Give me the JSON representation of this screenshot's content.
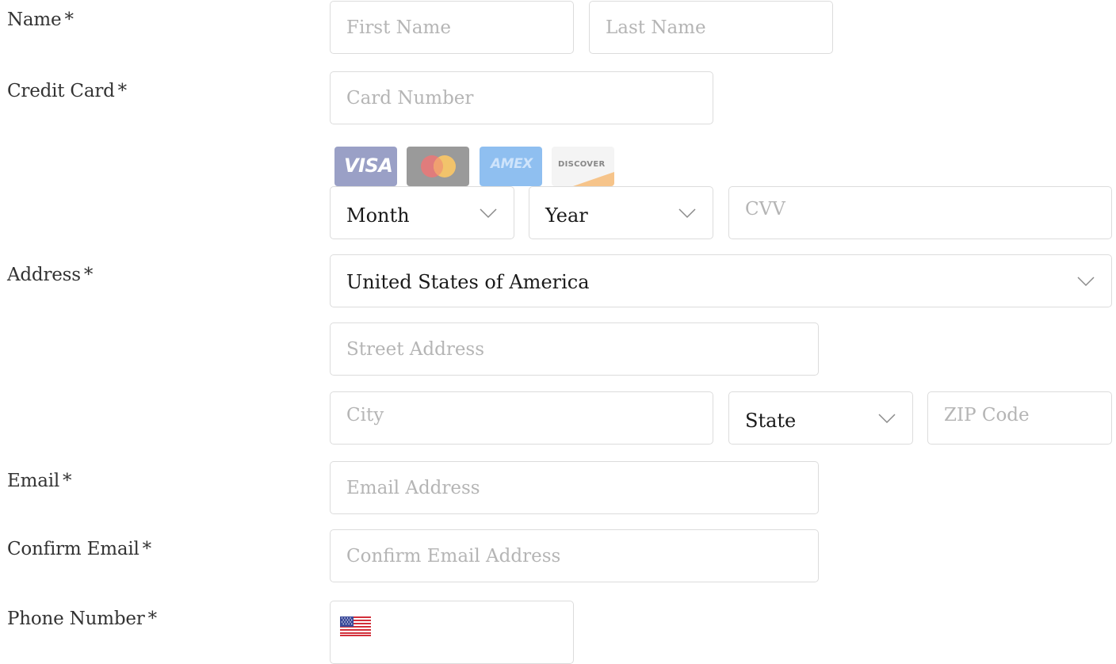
{
  "form": {
    "name": {
      "label": "Name",
      "required": "*",
      "first_placeholder": "First Name",
      "last_placeholder": "Last Name"
    },
    "credit_card": {
      "label": "Credit Card",
      "required": "*",
      "number_placeholder": "Card Number",
      "card_types": [
        {
          "name": "visa-icon",
          "text": "VISA"
        },
        {
          "name": "mastercard-icon",
          "text": ""
        },
        {
          "name": "amex-icon",
          "text": "AMEX"
        },
        {
          "name": "discover-icon",
          "text": "DISCOVER"
        }
      ],
      "month_value": "Month",
      "year_value": "Year",
      "cvv_placeholder": "CVV"
    },
    "address": {
      "label": "Address",
      "required": "*",
      "country_value": "United States of America",
      "street_placeholder": "Street Address",
      "city_placeholder": "City",
      "state_value": "State",
      "zip_placeholder": "ZIP Code"
    },
    "email": {
      "label": "Email",
      "required": "*",
      "placeholder": "Email Address"
    },
    "confirm_email": {
      "label": "Confirm Email",
      "required": "*",
      "placeholder": "Confirm Email Address"
    },
    "phone": {
      "label": "Phone Number",
      "required": "*",
      "flag_icon": "us-flag-icon"
    }
  },
  "colors": {
    "border": "#dcdcdc",
    "placeholder": "#b5b5b5",
    "text": "#333333"
  }
}
